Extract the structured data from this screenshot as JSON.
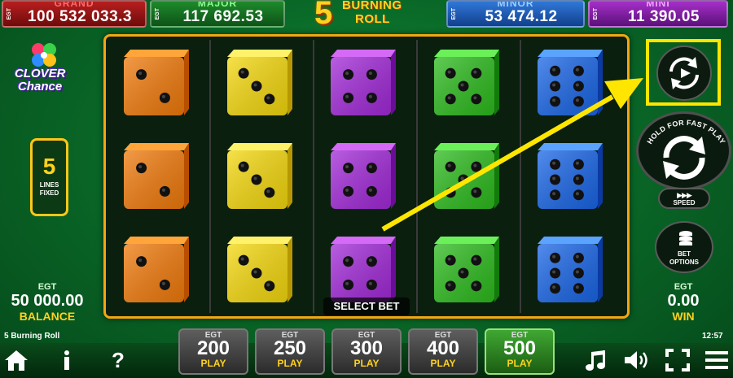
{
  "jackpots": {
    "grand": {
      "name": "GRAND",
      "egt": "EGT",
      "value": "100 532 033.3"
    },
    "major": {
      "name": "MAJOR",
      "egt": "EGT",
      "value": "117 692.53"
    },
    "minor": {
      "name": "MINOR",
      "egt": "EGT",
      "value": "53 474.12"
    },
    "mini": {
      "name": "MINI",
      "egt": "EGT",
      "value": "11 390.05"
    }
  },
  "title": {
    "number": "5",
    "word1": "BURNING",
    "word2": "ROLL"
  },
  "logo": {
    "line1": "CLOVER",
    "line2": "Chance"
  },
  "lines": {
    "count": "5",
    "label1": "LINES",
    "label2": "FIXED"
  },
  "balance": {
    "currency": "EGT",
    "value": "50 000.00",
    "label": "BALANCE"
  },
  "win": {
    "currency": "EGT",
    "value": "0.00",
    "label": "WIN"
  },
  "game_name": "5 Burning Roll",
  "clock": "12:57",
  "select_bet": "SELECT BET",
  "controls": {
    "spin_label": "HOLD FOR FAST PLAY",
    "speed_label": "SPEED",
    "bet_options_line1": "BET",
    "bet_options_line2": "OPTIONS"
  },
  "bets": [
    {
      "egt": "EGT",
      "amount": "200",
      "play": "PLAY"
    },
    {
      "egt": "EGT",
      "amount": "250",
      "play": "PLAY"
    },
    {
      "egt": "EGT",
      "amount": "300",
      "play": "PLAY"
    },
    {
      "egt": "EGT",
      "amount": "400",
      "play": "PLAY"
    },
    {
      "egt": "EGT",
      "amount": "500",
      "play": "PLAY",
      "active": true
    }
  ],
  "reels": [
    {
      "color": "orange",
      "faces": [
        2,
        2,
        2
      ]
    },
    {
      "color": "yellow",
      "faces": [
        3,
        3,
        3
      ]
    },
    {
      "color": "purple",
      "faces": [
        4,
        4,
        4
      ]
    },
    {
      "color": "green",
      "faces": [
        5,
        5,
        5
      ]
    },
    {
      "color": "blue",
      "faces": [
        6,
        6,
        6
      ]
    }
  ],
  "colors": {
    "orange": [
      "#ffa53a",
      "#f07a0c",
      "#b84f00"
    ],
    "yellow": [
      "#fff26a",
      "#f4d80e",
      "#b89800"
    ],
    "purple": [
      "#d46af5",
      "#a22ad8",
      "#6a0e99"
    ],
    "green": [
      "#6cf05a",
      "#2dbb1e",
      "#137a0c"
    ],
    "blue": [
      "#5aa4ff",
      "#1a66e6",
      "#0b3aa2"
    ],
    "accent": "#ffd21e",
    "highlight": "#ffe600"
  },
  "icons": {
    "home": "home-icon",
    "info": "info-icon",
    "help": "help-icon",
    "music": "music-icon",
    "sound": "sound-icon",
    "fullscreen": "fullscreen-icon",
    "menu": "menu-icon",
    "autoplay": "autoplay-icon"
  }
}
